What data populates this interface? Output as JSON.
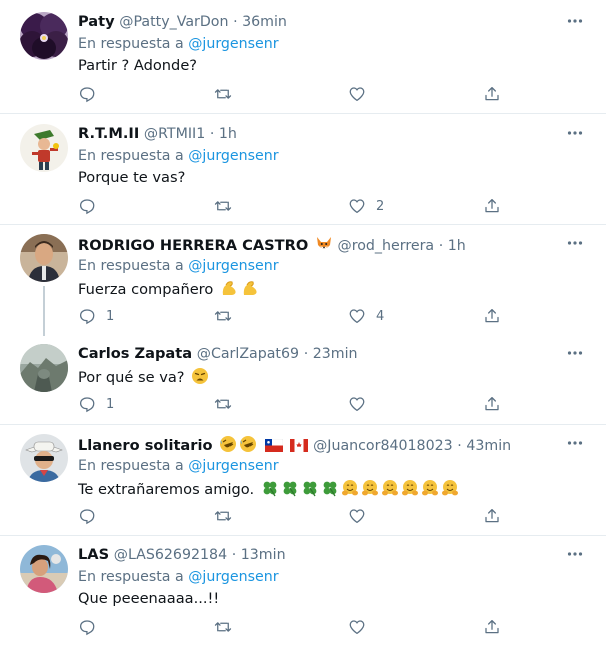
{
  "icons": [
    "reply-icon",
    "retweet-icon",
    "like-icon",
    "share-icon",
    "more-icon"
  ],
  "colors": {
    "link": "#1b95e0",
    "meta": "#5b7083",
    "divider": "#e6ecf0",
    "thread_line": "#c4cfd6"
  },
  "tweets": [
    {
      "name": "Paty",
      "handle": "@Patty_VarDon",
      "time": "· 36min",
      "reply_prefix": "En respuesta a",
      "reply_handle": "@jurgensenr",
      "text": "Partir ? Adonde?",
      "replies": "",
      "likes": ""
    },
    {
      "name": "R.T.M.II",
      "handle": "@RTMII1",
      "time": "· 1h",
      "reply_prefix": "En respuesta a",
      "reply_handle": "@jurgensenr",
      "text": "Porque te vas?",
      "replies": "",
      "likes": "2"
    },
    {
      "name": "RODRIGO HERRERA CASTRO",
      "handle": "@rod_herrera",
      "time": "· 1h",
      "name_emoji": "fox-emoji",
      "reply_prefix": "En respuesta a",
      "reply_handle": "@jurgensenr",
      "text": "Fuerza compañero",
      "text_emoji": "flexed-biceps-emoji ×2",
      "replies": "1",
      "likes": "4"
    },
    {
      "name": "Carlos Zapata",
      "handle": "@CarlZapat69",
      "time": "· 23min",
      "text": "Por qué se va?",
      "text_emoji": "weary-face-emoji",
      "replies": "1",
      "likes": ""
    },
    {
      "name": "Llanero solitario",
      "handle": "@Juancor84018023",
      "time": "· 43min",
      "name_emoji": "rolling-laughing-emoji ×2, chile-flag, canada-flag",
      "reply_prefix": "En respuesta a",
      "reply_handle": "@jurgensenr",
      "text": "Te extrañaremos amigo.",
      "text_emoji": "four-leaf-clover ×4, hugging-face ×6",
      "replies": "",
      "likes": ""
    },
    {
      "name": "LAS",
      "handle": "@LAS62692184",
      "time": "· 13min",
      "reply_prefix": "En respuesta a",
      "reply_handle": "@jurgensenr",
      "text": "Que peeenaaaa...!!",
      "replies": "",
      "likes": ""
    }
  ]
}
